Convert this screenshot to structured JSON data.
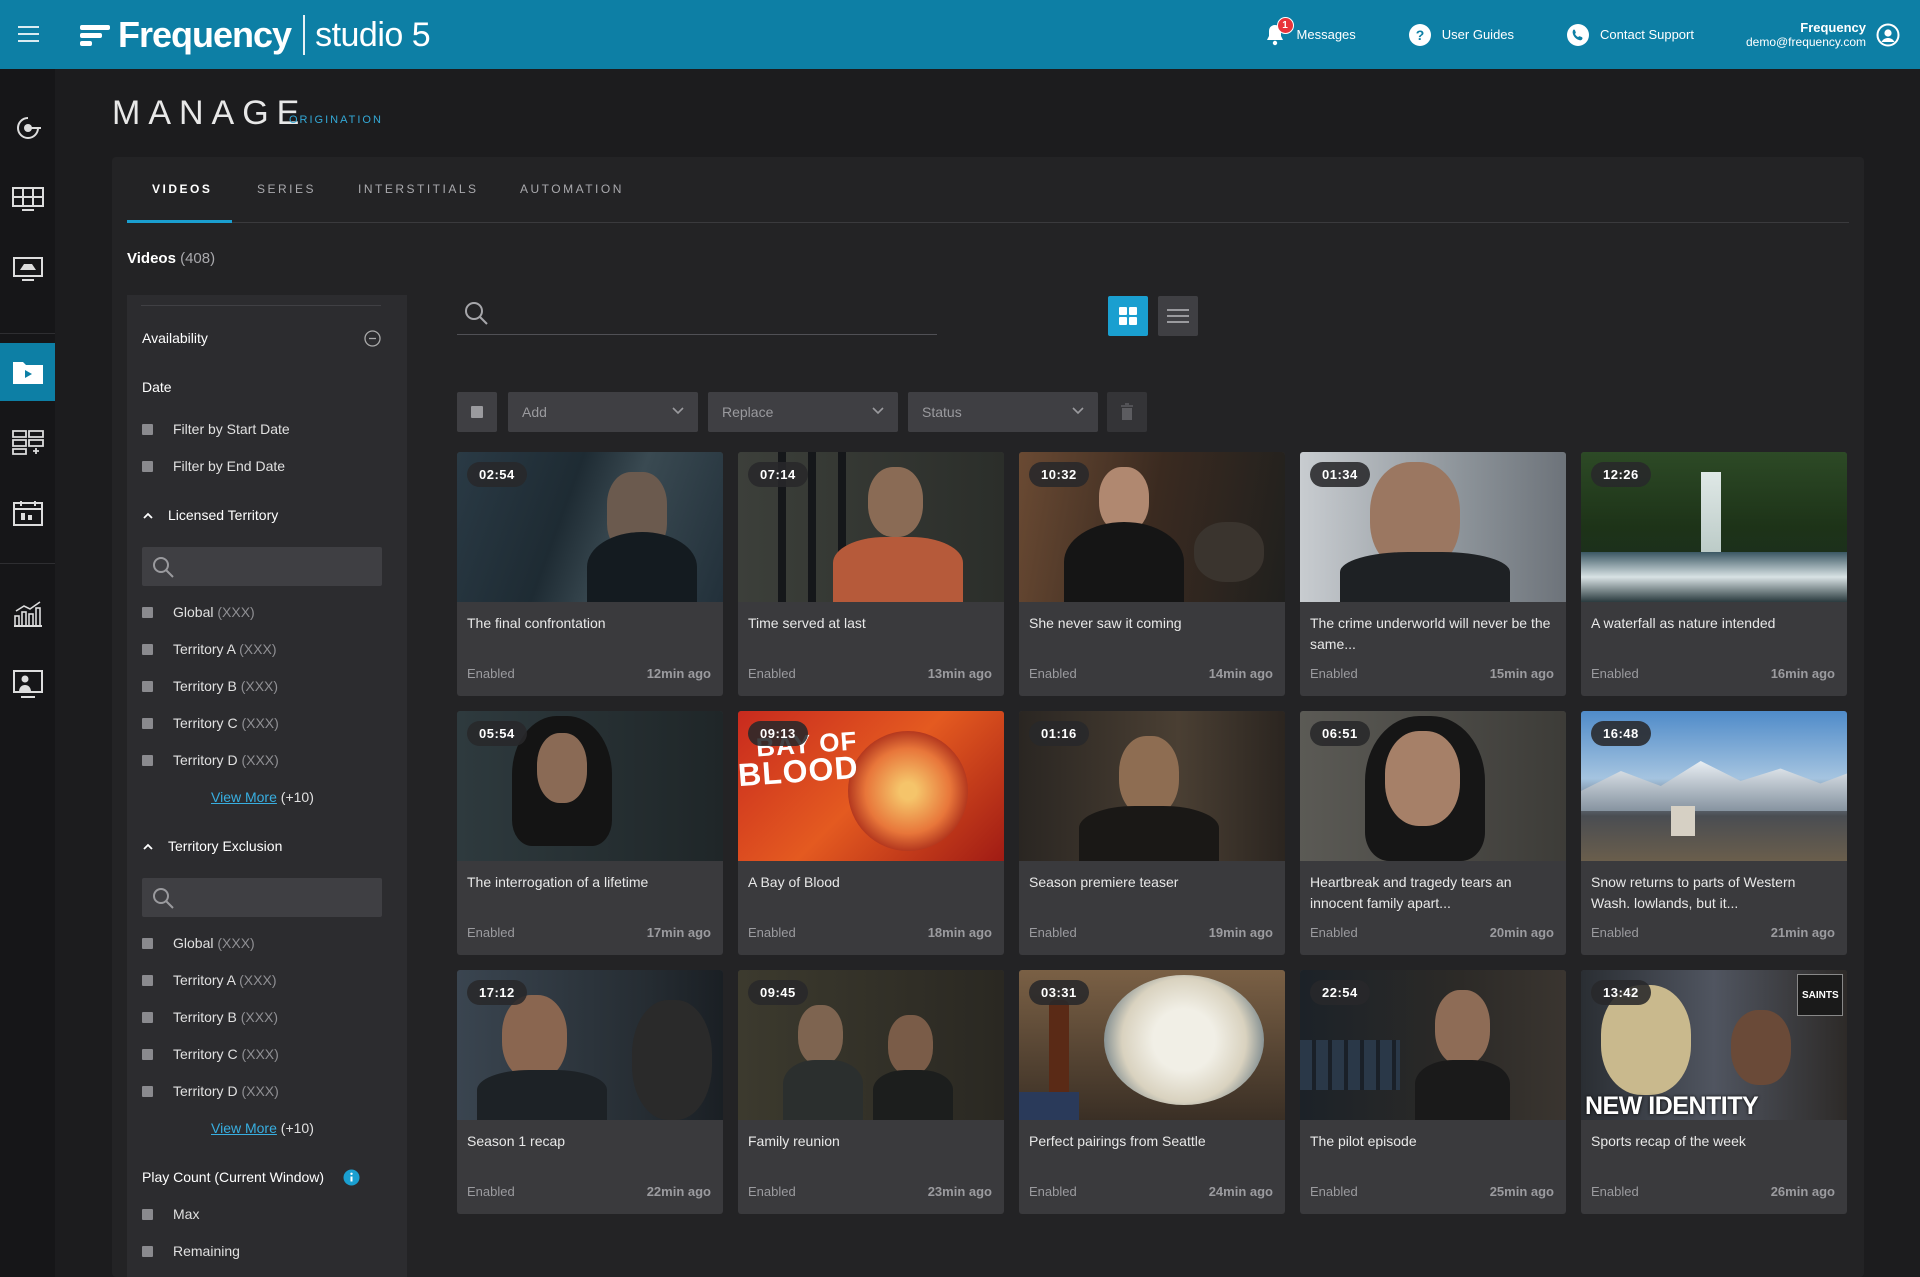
{
  "topbar": {
    "brand": "Frequency",
    "product": "studio 5",
    "messages_label": "Messages",
    "messages_badge": "1",
    "guides_label": "User Guides",
    "support_label": "Contact Support",
    "user_name": "Frequency",
    "user_email": "demo@frequency.com",
    "brand_color": "#0d7fa5"
  },
  "rail": [
    "upload-icon",
    "screens-icon",
    "display-icon",
    "folder-video-icon",
    "schedule-grid-icon",
    "calendar-icon",
    "analytics-icon",
    "presenter-icon"
  ],
  "header": {
    "title": "MANAGE",
    "subtitle": "ORIGINATION"
  },
  "tabs": [
    {
      "label": "VIDEOS"
    },
    {
      "label": "SERIES"
    },
    {
      "label": "INTERSTITIALS"
    },
    {
      "label": "AUTOMATION"
    }
  ],
  "videos_count": {
    "label": "Videos",
    "count": "(408)"
  },
  "filters": {
    "availability": "Availability",
    "date": "Date",
    "start_date": "Filter by Start Date",
    "end_date": "Filter by End Date",
    "licensed_territory": "Licensed Territory",
    "territory_exclusion": "Territory Exclusion",
    "territories": [
      {
        "name": "Global",
        "count": "(XXX)"
      },
      {
        "name": "Territory A",
        "count": "(XXX)"
      },
      {
        "name": "Territory B",
        "count": "(XXX)"
      },
      {
        "name": "Territory C",
        "count": "(XXX)"
      },
      {
        "name": "Territory D",
        "count": "(XXX)"
      }
    ],
    "view_more": "View More",
    "view_more_count": "(+10)",
    "play_count": "Play Count (Current Window)",
    "max": "Max",
    "remaining": "Remaining"
  },
  "toolbar": {
    "add": "Add",
    "replace": "Replace",
    "status": "Status"
  },
  "cards": [
    {
      "dur": "02:54",
      "title": "The final confrontation",
      "status": "Enabled",
      "time": "12min ago"
    },
    {
      "dur": "07:14",
      "title": "Time served at last",
      "status": "Enabled",
      "time": "13min ago"
    },
    {
      "dur": "10:32",
      "title": "She never saw it coming",
      "status": "Enabled",
      "time": "14min ago"
    },
    {
      "dur": "01:34",
      "title": "The crime underworld will never be the same...",
      "status": "Enabled",
      "time": "15min ago"
    },
    {
      "dur": "12:26",
      "title": "A waterfall as nature intended",
      "status": "Enabled",
      "time": "16min ago"
    },
    {
      "dur": "05:54",
      "title": "The interrogation of a lifetime",
      "status": "Enabled",
      "time": "17min ago"
    },
    {
      "dur": "09:13",
      "title": "A Bay of Blood",
      "status": "Enabled",
      "time": "18min ago"
    },
    {
      "dur": "01:16",
      "title": "Season premiere teaser",
      "status": "Enabled",
      "time": "19min ago"
    },
    {
      "dur": "06:51",
      "title": "Heartbreak and tragedy tears an innocent family apart...",
      "status": "Enabled",
      "time": "20min ago"
    },
    {
      "dur": "16:48",
      "title": "Snow returns to parts of Western Wash. lowlands, but it...",
      "status": "Enabled",
      "time": "21min ago"
    },
    {
      "dur": "17:12",
      "title": "Season 1 recap",
      "status": "Enabled",
      "time": "22min ago"
    },
    {
      "dur": "09:45",
      "title": "Family reunion",
      "status": "Enabled",
      "time": "23min ago"
    },
    {
      "dur": "03:31",
      "title": "Perfect pairings from Seattle",
      "status": "Enabled",
      "time": "24min ago"
    },
    {
      "dur": "22:54",
      "title": "The pilot episode",
      "status": "Enabled",
      "time": "25min ago"
    },
    {
      "dur": "13:42",
      "title": "Sports recap of the week",
      "status": "Enabled",
      "time": "26min ago"
    }
  ],
  "thumb_text": {
    "blood_top": "BAY OF",
    "blood_bottom": "BLOOD",
    "sports_banner": "NEW IDENTITY",
    "sports_badge": "SAINTS"
  }
}
